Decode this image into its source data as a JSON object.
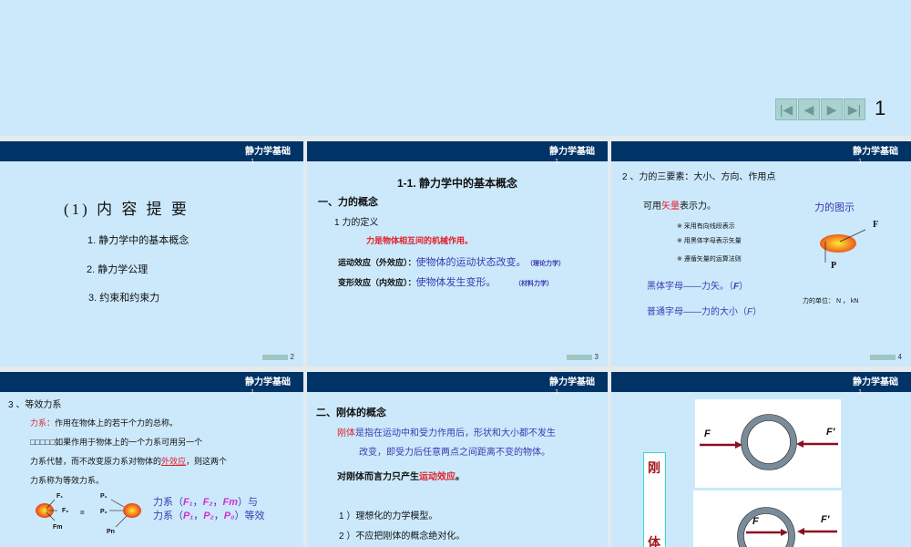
{
  "viewer": {
    "nav": [
      "first",
      "prev",
      "next",
      "last"
    ],
    "current_page": "1"
  },
  "header_title": "静力学基础",
  "header_num": "1",
  "slides": [
    {
      "page": "2",
      "title": "(1)  内 容 提 要",
      "items": [
        "1. 静力学中的基本概念",
        "2.  静力学公理",
        "3. 约束和约束力"
      ]
    },
    {
      "page": "3",
      "title": "1-1. 静力学中的基本概念",
      "section": "一、力的概念",
      "sub": "1 力的定义",
      "def": "力是物体相互间的机械作用。",
      "l1a": "运动效应（外效应）：",
      "l1b": "使物体的运动状态改变。",
      "l1c": "（理论力学）",
      "l2a": "变形效应（内效应）：",
      "l2b": "使物体发生变形。",
      "l2c": "（材料力学）"
    },
    {
      "page": "4",
      "heading": "2 、力的三要素：大小、方向、作用点",
      "vec_a": "可用",
      "vec_b": "矢量",
      "vec_c": "表示力。",
      "diagram_title": "力的图示",
      "notes": [
        "※ 采用有向线段表示",
        "※ 用黑体字母表示矢量",
        "※ 遵循矢量的运算法则"
      ],
      "F": "F",
      "P": "P",
      "bold_a": "黑体字母——力矢。（",
      "bold_b": "F",
      "bold_c": "）",
      "plain_a": "普通字母——力的大小（",
      "plain_b": "F",
      "plain_c": "）",
      "unit": "力的单位： N ， kN"
    },
    {
      "heading": "3 、等效力系",
      "def_a": "力系：",
      "def_b": "作用在物体上的若干个力的总称。",
      "eq1": "□□□□□如果作用于物体上的一个力系可用另一个",
      "eq2_a": "力系代替，而不改变原力系对物体的",
      "eq2_b": "外效应",
      "eq2_c": "，则这两个",
      "eq3": "力系称为等效力系。",
      "labels": {
        "F1": "F₁",
        "F2": "F₂",
        "Fm": "Fm",
        "P1": "P₁",
        "P2": "P₂",
        "Pn": "Pn",
        "eq": "="
      },
      "r1": [
        "力系（",
        "F₁",
        "，",
        "F₂",
        "，",
        "Fm",
        "）与"
      ],
      "r2": [
        "力系（",
        "P₁",
        "，",
        "P₂",
        "，",
        "P₀",
        "）等效"
      ]
    },
    {
      "section": "二、刚体的概念",
      "d_a": "刚体",
      "d_b": "是指在运动中和受力作用后，形状和大小都不发生",
      "d_c": "改变，即受力后任意两点之间距离不变的物体。",
      "e_a": "对刚体而言力只产生",
      "e_b": "运动效应",
      "e_c": "。",
      "p1": "1 ）理想化的力学模型。",
      "p2": "2 ）不应把刚体的概念绝对化。"
    },
    {
      "vertical": [
        "刚",
        "体"
      ],
      "fig1": [
        "F",
        "F′"
      ],
      "fig2": [
        "F",
        "F′"
      ]
    }
  ]
}
